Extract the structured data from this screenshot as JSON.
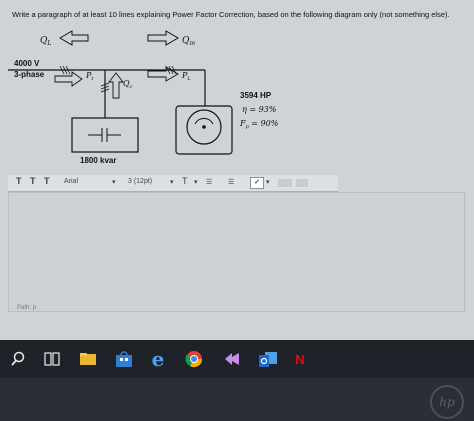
{
  "question": {
    "text": "Write a paragraph of at least 10 lines explaining Power Factor Correction, based on the following diagram only (not something else)."
  },
  "diagram": {
    "labels": {
      "q_l": "Q",
      "q_l_sub": "L",
      "q_m": "Q",
      "q_m_sub": "m",
      "supply_voltage": "4000 V",
      "supply_phase": "3-phase",
      "p_t": "P",
      "p_t_sub": "t",
      "q_c": "Q",
      "q_c_sub": "c",
      "p_l": "P",
      "p_l_sub": "L",
      "capacitor_rating": "1800 kvar",
      "motor_power": "3594 HP",
      "motor_efficiency": "η = 93%",
      "motor_pf": "F",
      "motor_pf_sub": "p",
      "motor_pf_value": " = 90%"
    }
  },
  "toolbar": {
    "heading_1": "T",
    "heading_2": "T",
    "heading_3": "T",
    "font_family": "Arial",
    "font_size": "3 (12pt)",
    "text_color": "T",
    "bullet_list": "☰",
    "numbered_list": "☰",
    "spellcheck": "✓"
  },
  "editor": {
    "path_label": "Path: p"
  },
  "taskbar": {
    "icons": [
      "search-icon",
      "task-view-icon",
      "file-explorer-icon",
      "store-icon",
      "edge-icon",
      "chrome-icon",
      "app-icon",
      "outlook-icon",
      "netflix-icon"
    ],
    "edge_glyph": "e",
    "netflix_glyph": "N"
  },
  "bezel": {
    "logo": "hp"
  }
}
